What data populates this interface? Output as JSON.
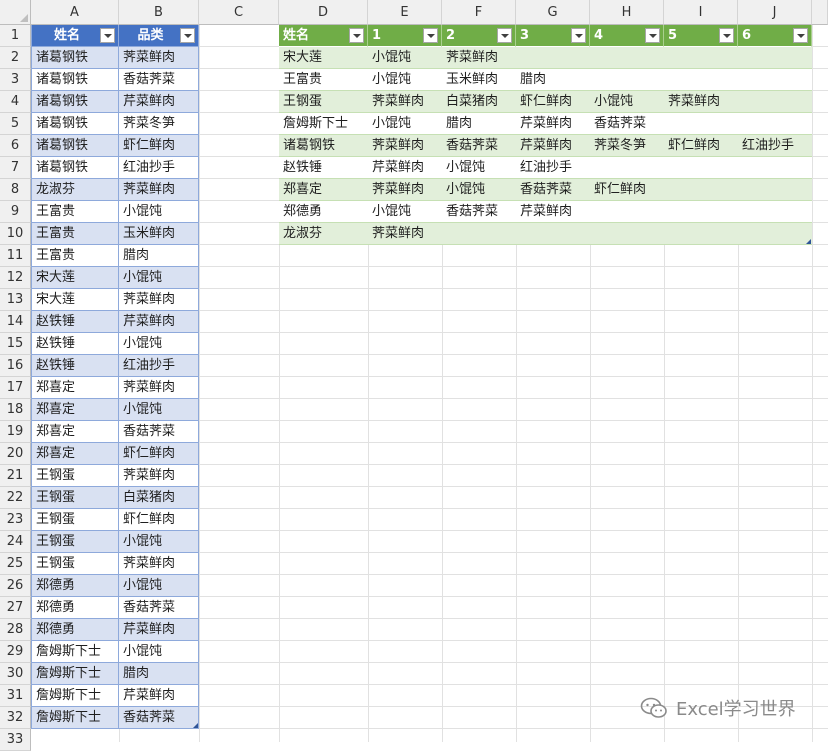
{
  "columns": [
    "A",
    "B",
    "C",
    "D",
    "E",
    "F",
    "G",
    "H",
    "I",
    "J"
  ],
  "rows": [
    "1",
    "2",
    "3",
    "4",
    "5",
    "6",
    "7",
    "8",
    "9",
    "10",
    "11",
    "12",
    "13",
    "14",
    "15",
    "16",
    "17",
    "18",
    "19",
    "20",
    "21",
    "22",
    "23",
    "24",
    "25",
    "26",
    "27",
    "28",
    "29",
    "30",
    "31",
    "32",
    "33"
  ],
  "table1": {
    "headers": [
      "姓名",
      "品类"
    ],
    "rows": [
      [
        "诸葛钢铁",
        "荠菜鲜肉"
      ],
      [
        "诸葛钢铁",
        "香菇荠菜"
      ],
      [
        "诸葛钢铁",
        "芹菜鲜肉"
      ],
      [
        "诸葛钢铁",
        "荠菜冬笋"
      ],
      [
        "诸葛钢铁",
        "虾仁鲜肉"
      ],
      [
        "诸葛钢铁",
        "红油抄手"
      ],
      [
        "龙淑芬",
        "荠菜鲜肉"
      ],
      [
        "王富贵",
        "小馄饨"
      ],
      [
        "王富贵",
        "玉米鲜肉"
      ],
      [
        "王富贵",
        "腊肉"
      ],
      [
        "宋大莲",
        "小馄饨"
      ],
      [
        "宋大莲",
        "荠菜鲜肉"
      ],
      [
        "赵铁锤",
        "芹菜鲜肉"
      ],
      [
        "赵铁锤",
        "小馄饨"
      ],
      [
        "赵铁锤",
        "红油抄手"
      ],
      [
        "郑喜定",
        "荠菜鲜肉"
      ],
      [
        "郑喜定",
        "小馄饨"
      ],
      [
        "郑喜定",
        "香菇荠菜"
      ],
      [
        "郑喜定",
        "虾仁鲜肉"
      ],
      [
        "王钢蛋",
        "荠菜鲜肉"
      ],
      [
        "王钢蛋",
        "白菜猪肉"
      ],
      [
        "王钢蛋",
        "虾仁鲜肉"
      ],
      [
        "王钢蛋",
        "小馄饨"
      ],
      [
        "王钢蛋",
        "荠菜鲜肉"
      ],
      [
        "郑德勇",
        "小馄饨"
      ],
      [
        "郑德勇",
        "香菇荠菜"
      ],
      [
        "郑德勇",
        "芹菜鲜肉"
      ],
      [
        "詹姆斯下士",
        "小馄饨"
      ],
      [
        "詹姆斯下士",
        "腊肉"
      ],
      [
        "詹姆斯下士",
        "芹菜鲜肉"
      ],
      [
        "詹姆斯下士",
        "香菇荠菜"
      ]
    ]
  },
  "table2": {
    "headers": [
      "姓名",
      "1",
      "2",
      "3",
      "4",
      "5",
      "6"
    ],
    "rows": [
      [
        "宋大莲",
        "小馄饨",
        "荠菜鲜肉",
        "",
        "",
        "",
        ""
      ],
      [
        "王富贵",
        "小馄饨",
        "玉米鲜肉",
        "腊肉",
        "",
        "",
        ""
      ],
      [
        "王钢蛋",
        "荠菜鲜肉",
        "白菜猪肉",
        "虾仁鲜肉",
        "小馄饨",
        "荠菜鲜肉",
        ""
      ],
      [
        "詹姆斯下士",
        "小馄饨",
        "腊肉",
        "芹菜鲜肉",
        "香菇荠菜",
        "",
        ""
      ],
      [
        "诸葛钢铁",
        "荠菜鲜肉",
        "香菇荠菜",
        "芹菜鲜肉",
        "荠菜冬笋",
        "虾仁鲜肉",
        "红油抄手"
      ],
      [
        "赵铁锤",
        "芹菜鲜肉",
        "小馄饨",
        "红油抄手",
        "",
        "",
        ""
      ],
      [
        "郑喜定",
        "荠菜鲜肉",
        "小馄饨",
        "香菇荠菜",
        "虾仁鲜肉",
        "",
        ""
      ],
      [
        "郑德勇",
        "小馄饨",
        "香菇荠菜",
        "芹菜鲜肉",
        "",
        "",
        ""
      ],
      [
        "龙淑芬",
        "荠菜鲜肉",
        "",
        "",
        "",
        "",
        ""
      ]
    ]
  },
  "watermark": {
    "text": "Excel学习世界",
    "icon": "wechat-icon"
  },
  "colors": {
    "table1_header": "#4472c4",
    "table1_band": "#d9e1f2",
    "table2_header": "#70ad47",
    "table2_band": "#e2efda"
  }
}
